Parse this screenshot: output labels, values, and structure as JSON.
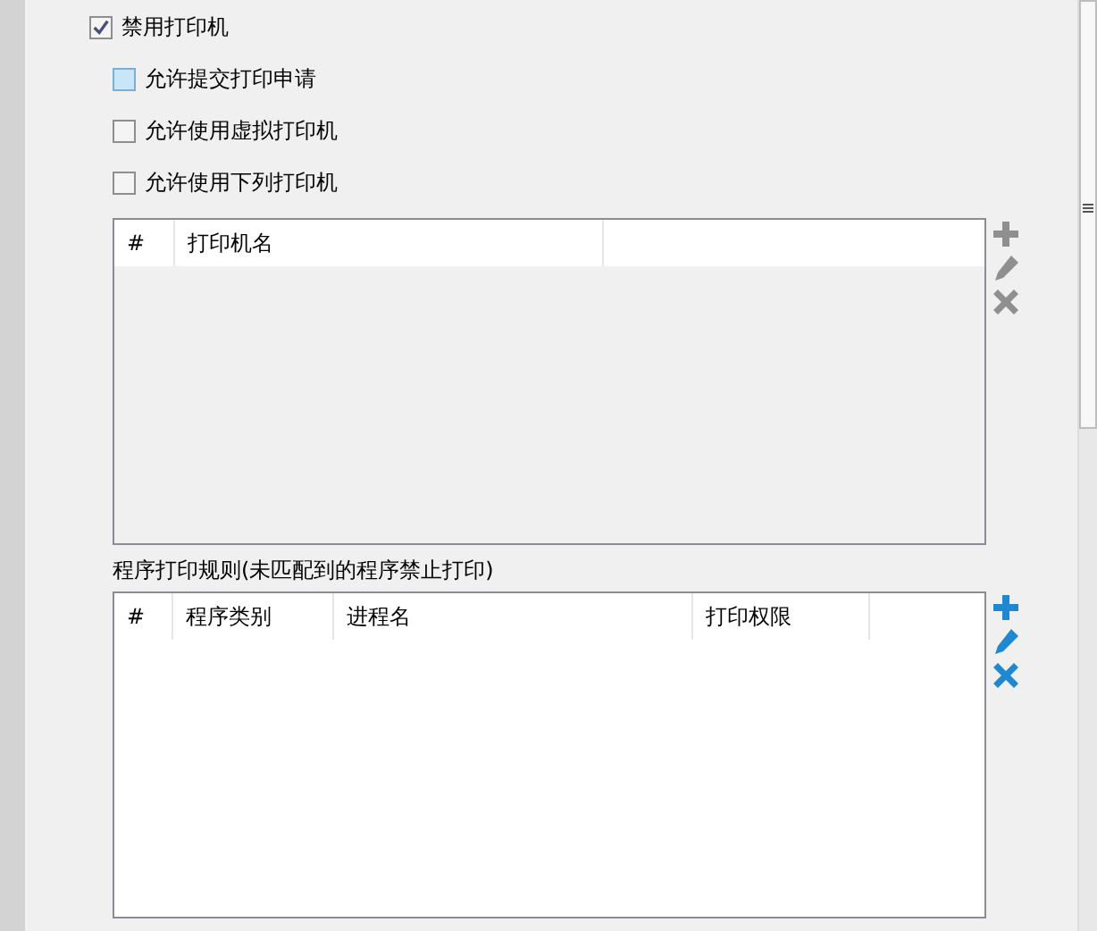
{
  "printer_disable": {
    "label": "禁用打印机",
    "checked": true,
    "children": [
      {
        "label": "允许提交打印申请",
        "checked": false,
        "highlighted": true
      },
      {
        "label": "允许使用虚拟打印机",
        "checked": false,
        "highlighted": false
      },
      {
        "label": "允许使用下列打印机",
        "checked": false,
        "highlighted": false
      }
    ]
  },
  "tables": [
    {
      "columns": [
        "#",
        "打印机名"
      ],
      "disabled": true
    },
    {
      "title": "程序打印规则(未匹配到的程序禁止打印)",
      "columns": [
        "#",
        "程序类别",
        "进程名",
        "打印权限"
      ],
      "disabled": false
    }
  ]
}
